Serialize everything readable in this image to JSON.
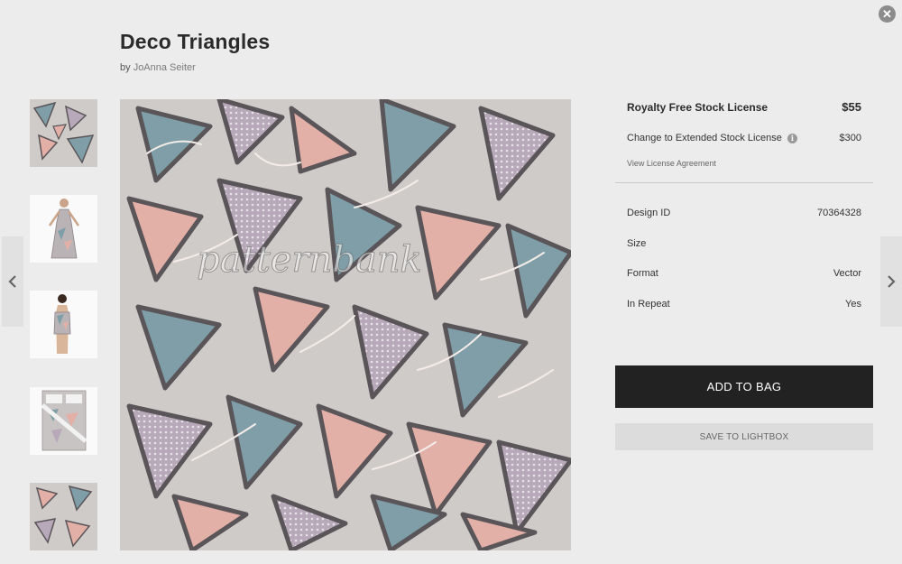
{
  "product": {
    "title": "Deco Triangles",
    "by_label": "by",
    "author": "JoAnna Seiter",
    "watermark": "patternbank"
  },
  "close_glyph": "✕",
  "nav": {
    "prev_icon": "chevron-left-icon",
    "next_icon": "chevron-right-icon"
  },
  "thumbnails": [
    {
      "kind": "pattern-swatch"
    },
    {
      "kind": "dress-mockup"
    },
    {
      "kind": "swimsuit-mockup"
    },
    {
      "kind": "bedding-mockup"
    },
    {
      "kind": "pattern-swatch"
    }
  ],
  "license": {
    "standard_label": "Royalty Free Stock License",
    "standard_price": "$55",
    "extended_label": "Change to Extended Stock License",
    "extended_price": "$300",
    "info_glyph": "i",
    "agreement_link": "View License Agreement"
  },
  "details": [
    {
      "label": "Design ID",
      "value": "70364328"
    },
    {
      "label": "Size",
      "value": ""
    },
    {
      "label": "Format",
      "value": "Vector"
    },
    {
      "label": "In Repeat",
      "value": "Yes"
    }
  ],
  "actions": {
    "add_to_bag": "ADD TO BAG",
    "save_to_lightbox": "SAVE TO LIGHTBOX"
  },
  "colors": {
    "background": "#ececec",
    "pattern_bg": "#cfcbc8",
    "teal": "#7f9ea7",
    "pink": "#e3b0a8",
    "lilac": "#b7a9b9",
    "dark_outline": "#5a5559",
    "button_dark": "#222222"
  }
}
